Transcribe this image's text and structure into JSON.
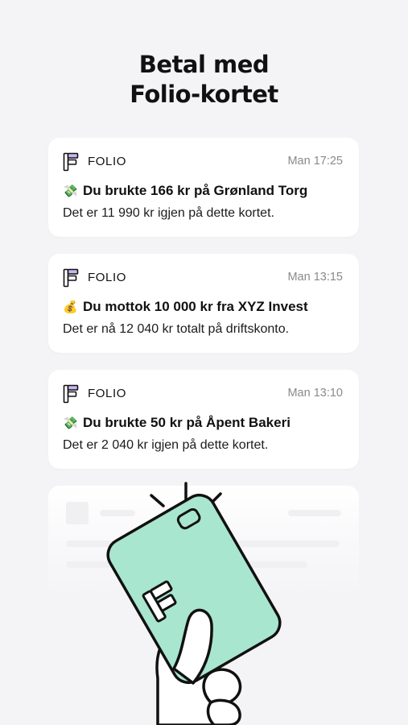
{
  "header": {
    "title_line1": "Betal med",
    "title_line2": "Folio-kortet"
  },
  "notifications": [
    {
      "app": "FOLIO",
      "time": "Man 17:25",
      "icon": "money-with-wings-icon",
      "headline": "Du brukte 166 kr på Grønland Torg",
      "body": "Det er 11 990 kr igjen på dette kortet."
    },
    {
      "app": "FOLIO",
      "time": "Man 13:15",
      "icon": "money-bag-icon",
      "headline": "Du mottok 10 000 kr fra XYZ Invest",
      "body": "Det er nå 12 040 kr totalt på driftskonto."
    },
    {
      "app": "FOLIO",
      "time": "Man 13:10",
      "icon": "money-with-wings-icon",
      "headline": "Du brukte 50 kr på Åpent Bakeri",
      "body": "Det er 2 040 kr igjen på dette kortet."
    }
  ],
  "colors": {
    "background": "#f4f4f6",
    "card": "#ffffff",
    "folio_card_mint": "#a8e6cf",
    "logo_purple": "#c8b6f2",
    "outline": "#111111"
  }
}
